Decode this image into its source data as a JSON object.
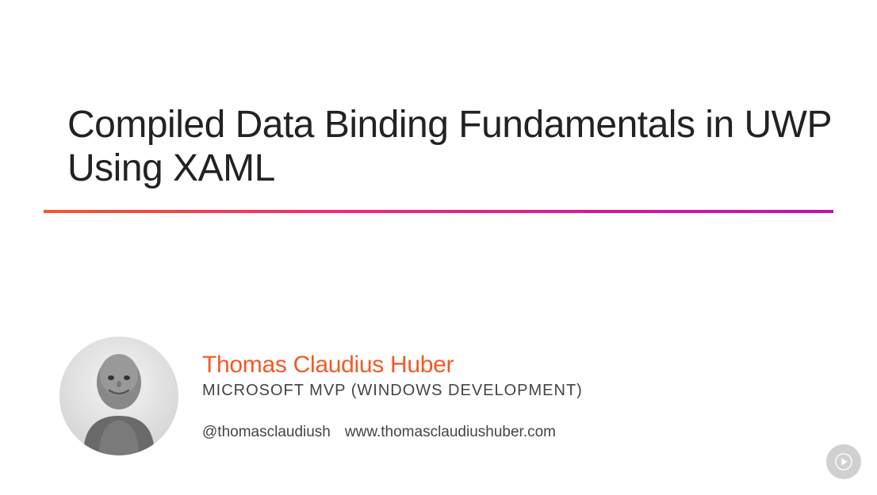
{
  "title": "Compiled Data Binding Fundamentals in UWP Using XAML",
  "author": {
    "name": "Thomas Claudius Huber",
    "role": "MICROSOFT MVP (WINDOWS DEVELOPMENT)",
    "twitter": "@thomasclaudiush",
    "website": "www.thomasclaudiushuber.com"
  },
  "colors": {
    "accent": "#f05a28",
    "gradient_start": "#f05a28",
    "gradient_end": "#c90fab"
  },
  "play_icon": "play-icon"
}
